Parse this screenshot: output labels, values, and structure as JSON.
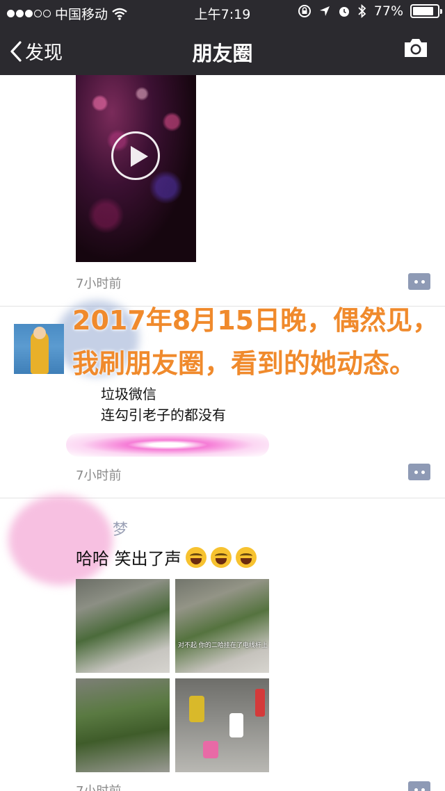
{
  "status_bar": {
    "carrier": "中国移动",
    "time": "上午7:19",
    "battery": "77%",
    "signal_dots_filled": 3,
    "signal_dots_total": 5
  },
  "nav": {
    "back_label": "发现",
    "title": "朋友圈"
  },
  "posts": [
    {
      "timestamp": "7小时前"
    },
    {
      "overlay_lines": [
        "2017年8月15日晚，偶然见，",
        "我刷朋友圈，看到的她动态。"
      ],
      "text_lines": [
        "垃圾微信",
        "连勾引老子的都没有"
      ],
      "timestamp": "7小时前"
    },
    {
      "author": "梦",
      "caption": "哈哈 笑出了声",
      "image_subtitle": "对不起 你的二哈挂在了电线杆上",
      "timestamp": "7小时前"
    }
  ],
  "colors": {
    "header_bg": "#2b2a2f",
    "overlay_text": "#f08a2c",
    "timestamp": "#8a8a8a",
    "comment_button": "#8e9ab5"
  },
  "icons": [
    "wifi-icon",
    "lock-rotation-icon",
    "location-arrow-icon",
    "alarm-icon",
    "bluetooth-icon",
    "battery-icon",
    "back-chevron-icon",
    "camera-icon",
    "play-icon",
    "comment-icon",
    "laughing-emoji-icon"
  ]
}
